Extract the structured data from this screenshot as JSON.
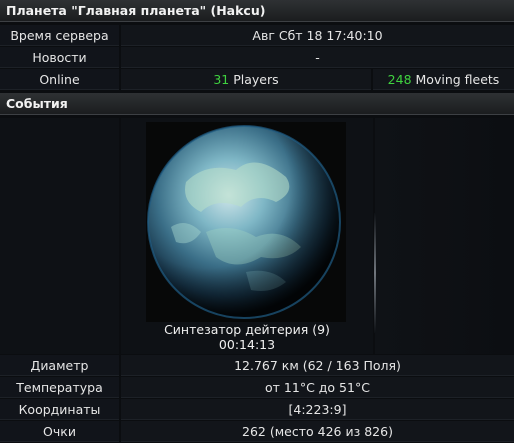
{
  "header": {
    "title": "Планета \"Главная планета\" (Hakcu)"
  },
  "server_time": {
    "label": "Время сервера",
    "value": "Авг Сбт 18 17:40:10"
  },
  "news": {
    "label": "Новости",
    "value": "-"
  },
  "online": {
    "label": "Online",
    "players_count": "31",
    "players_label": "Players",
    "fleets_count": "248",
    "fleets_label": "Moving fleets"
  },
  "events": {
    "title": "События",
    "building": "Синтезатор дейтерия (9)",
    "timer": "00:14:13"
  },
  "stats": {
    "diameter": {
      "label": "Диаметр",
      "value": "12.767 км (62 / 163 Поля)"
    },
    "temperature": {
      "label": "Температура",
      "value": "от 11°С до 51°С"
    },
    "coordinates": {
      "label": "Координаты",
      "value": "[4:223:9]"
    },
    "points": {
      "label": "Очки",
      "value": "262 (место 426 из 826)"
    }
  },
  "colors": {
    "accent_green": "#3fd13f",
    "cell_bg": "#12151a",
    "header_bg": "#2e3134"
  }
}
